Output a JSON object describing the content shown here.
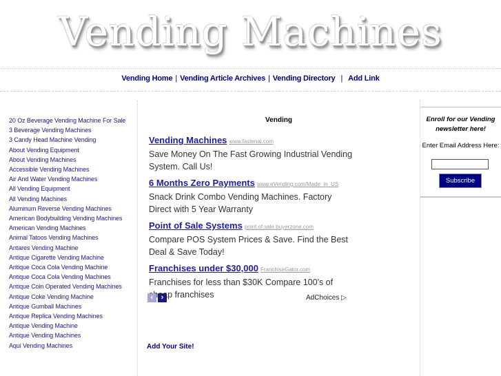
{
  "header": {
    "logo_text": "Vending Machines"
  },
  "nav": {
    "items": [
      {
        "label": "Vending Home"
      },
      {
        "label": "Vending Article Archives"
      },
      {
        "label": "Vending Directory"
      },
      {
        "label": "Add Link"
      }
    ],
    "separator": "|"
  },
  "sidebar": {
    "links": [
      "20 Oz Beverage Vending Machine For Sale",
      "3 Beverage Vending Machines",
      "3 Candy Head Machine Vending",
      "About Vending Equipment",
      "About Vending Machines",
      "Accessible Vending Machines",
      "Air And Water Vending Machines",
      "All Vending Equipment",
      "All Vending Machines",
      "Aluminum Reverse Vending Machines",
      "American Bodybuilding Vending Machines",
      "American Vending Machines",
      "Animal Tatoos Vending Machines",
      "Antares Vending Machine",
      "Antique Cigarette Vending Machine",
      "Antique Coca Cola Vending Machine",
      "Antique Coca Cola Vending Machines",
      "Antique Coin Operated Vending Machines",
      "Antique Coke Vending Machine",
      "Antique Gumball Machines",
      "Antique Replica Vending Machines",
      "Antique Vending Machine",
      "Antique Vending Machines",
      "Aqui Vending Machines"
    ]
  },
  "main": {
    "title": "Vending",
    "ads": [
      {
        "title": "Vending Machines",
        "url": "www.fastenal.com",
        "desc": "Save Money On The Fast Growing Industrial Vending System. Call Us!"
      },
      {
        "title": "6 Months Zero Payments",
        "url": "www.eVending.com/Made_in_US",
        "desc": "Snack Drink Combo Vending Machines. Factory Direct with 5 Year Warranty"
      },
      {
        "title": "Point of Sale Systems",
        "url": "point.of.sale.buyerzone.com",
        "desc": "Compare POS System Prices & Save. Find the Best Deal & Save Today!"
      },
      {
        "title": "Franchises under $30,000",
        "url": "FranchiseGator.com",
        "desc": "Franchises for less than $30K Compare 100's of cheap franchises"
      }
    ],
    "ad_prev_icon": "‹",
    "ad_next_icon": "›",
    "adchoices_label": "AdChoices",
    "adchoices_icon": "▷",
    "add_site_label": "Add Your Site!"
  },
  "newsletter": {
    "heading": "Enroll for our Vending newsletter here!",
    "email_label": "Enter Email Address Here:",
    "email_value": "",
    "subscribe_label": "Subscribe"
  }
}
